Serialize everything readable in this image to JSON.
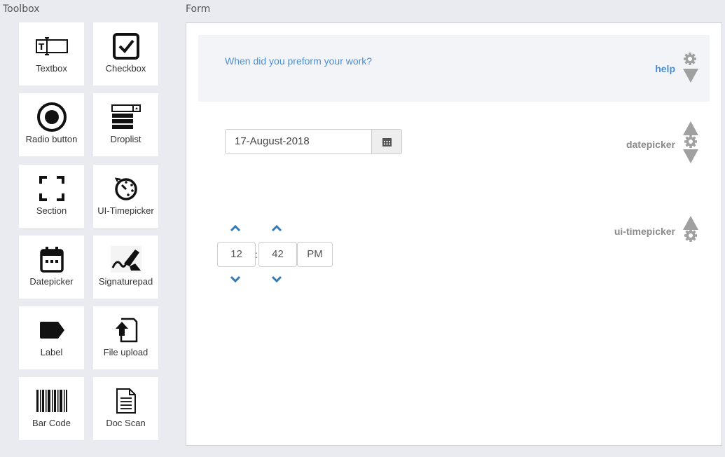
{
  "toolbox": {
    "title": "Toolbox",
    "items": [
      {
        "label": "Textbox",
        "icon": "textbox-icon"
      },
      {
        "label": "Checkbox",
        "icon": "checkbox-icon"
      },
      {
        "label": "Radio button",
        "icon": "radio-button-icon"
      },
      {
        "label": "Droplist",
        "icon": "droplist-icon"
      },
      {
        "label": "Section",
        "icon": "section-icon"
      },
      {
        "label": "UI-Timepicker",
        "icon": "timepicker-icon"
      },
      {
        "label": "Datepicker",
        "icon": "calendar-icon"
      },
      {
        "label": "Signaturepad",
        "icon": "signature-icon"
      },
      {
        "label": "Label",
        "icon": "label-tag-icon"
      },
      {
        "label": "File upload",
        "icon": "file-upload-icon"
      },
      {
        "label": "Bar Code",
        "icon": "barcode-icon"
      },
      {
        "label": "Doc Scan",
        "icon": "document-icon"
      }
    ]
  },
  "form": {
    "title": "Form",
    "help": {
      "question": "When did you preform your work?",
      "label": "help"
    },
    "datepicker": {
      "value": "17-August-2018",
      "label": "datepicker"
    },
    "timepicker": {
      "hours": "12",
      "separator": ":",
      "minutes": "42",
      "meridian": "PM",
      "label": "ui-timepicker"
    }
  },
  "colors": {
    "accent": "#4a8fd6",
    "background": "#e9ebf1",
    "muted_icon": "#a0a0a0"
  }
}
